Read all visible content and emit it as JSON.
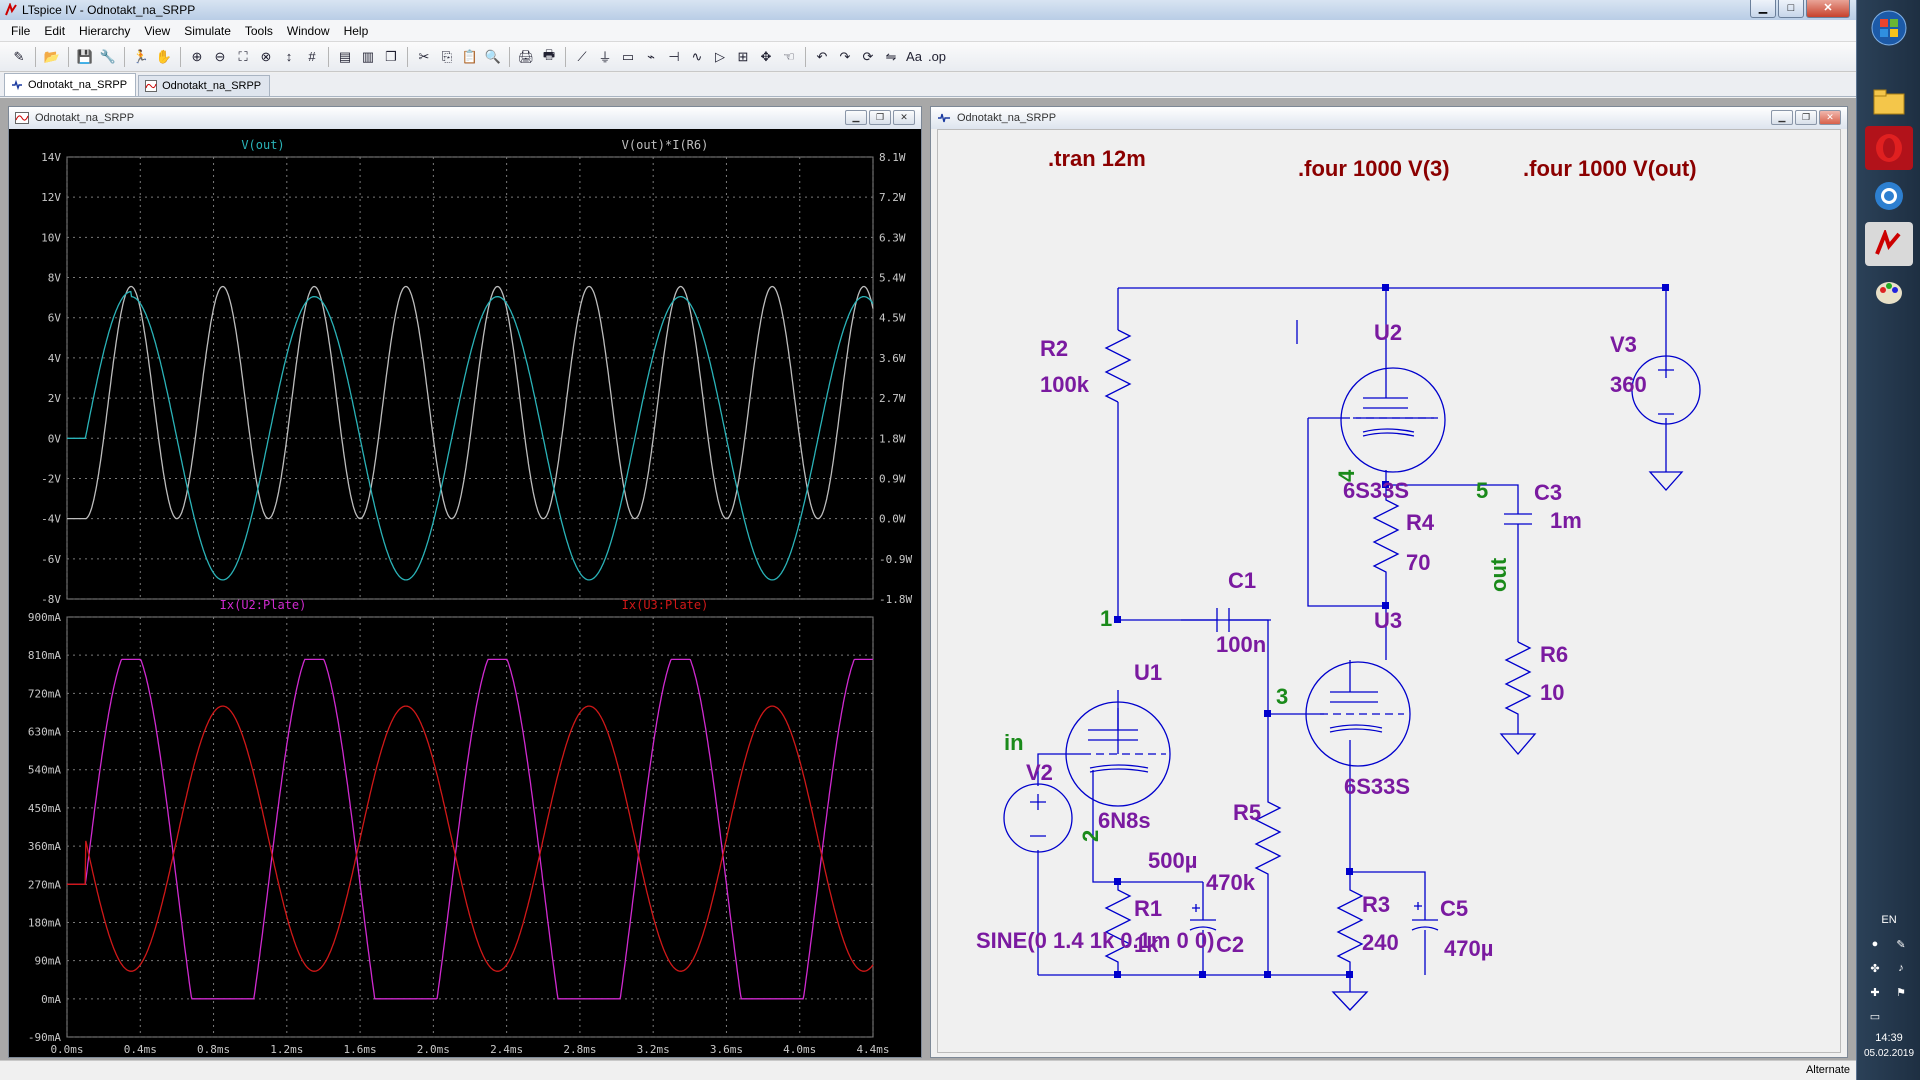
{
  "window": {
    "title": "LTspice IV - Odnotakt_na_SRPP",
    "minimize": "▁",
    "maximize": "□",
    "close": "✕"
  },
  "menu": [
    "File",
    "Edit",
    "Hierarchy",
    "View",
    "Simulate",
    "Tools",
    "Window",
    "Help"
  ],
  "toolbar_icons": [
    "new-schematic-icon",
    "open-icon",
    "save-icon",
    "control-panel-icon",
    "run-icon",
    "halt-icon",
    "zoom-in-icon",
    "zoom-out-icon",
    "zoom-fit-icon",
    "zoom-cancel-icon",
    "autorange-icon",
    "grid-icon",
    "tile-horizontal-icon",
    "tile-vertical-icon",
    "cascade-icon",
    "cut-icon",
    "copy-icon",
    "paste-icon",
    "find-icon",
    "print-setup-icon",
    "print-icon",
    "wire-icon",
    "ground-icon",
    "label-icon",
    "resistor-icon",
    "capacitor-icon",
    "inductor-icon",
    "diode-icon",
    "component-icon",
    "move-icon",
    "drag-icon",
    "undo-icon",
    "redo-icon",
    "rotate-icon",
    "mirror-icon",
    "text-icon",
    "spice-directive-icon"
  ],
  "tabs": [
    {
      "label": "Odnotakt_na_SRPP",
      "icon": "schematic-icon",
      "active": true
    },
    {
      "label": "Odnotakt_na_SRPP",
      "icon": "waveform-icon",
      "active": false
    }
  ],
  "plot_window": {
    "title": "Odnotakt_na_SRPP",
    "pane1": {
      "traces": [
        {
          "label": "V(out)",
          "color": "#2ab3b8"
        },
        {
          "label": "V(out)*I(R6)",
          "color": "#bfbfbf"
        }
      ],
      "left_ticks": [
        "14V",
        "12V",
        "10V",
        "8V",
        "6V",
        "4V",
        "2V",
        "0V",
        "-2V",
        "-4V",
        "-6V",
        "-8V"
      ],
      "right_ticks": [
        "8.1W",
        "7.2W",
        "6.3W",
        "5.4W",
        "4.5W",
        "3.6W",
        "2.7W",
        "1.8W",
        "0.9W",
        "0.0W",
        "-0.9W",
        "-1.8W"
      ]
    },
    "pane2": {
      "traces": [
        {
          "label": "Ix(U2:Plate)",
          "color": "#d02ad0"
        },
        {
          "label": "Ix(U3:Plate)",
          "color": "#d01818"
        }
      ],
      "left_ticks": [
        "900mA",
        "810mA",
        "720mA",
        "630mA",
        "540mA",
        "450mA",
        "360mA",
        "270mA",
        "180mA",
        "90mA",
        "0mA",
        "-90mA"
      ]
    },
    "x_ticks": [
      "0.0ms",
      "0.4ms",
      "0.8ms",
      "1.2ms",
      "1.6ms",
      "2.0ms",
      "2.4ms",
      "2.8ms",
      "3.2ms",
      "3.6ms",
      "4.0ms",
      "4.4ms"
    ]
  },
  "chart_data": [
    {
      "type": "line",
      "title": "",
      "xlabel": "",
      "ylabel": "",
      "xlim": [
        0,
        4.4
      ],
      "ylim": [
        -8,
        14
      ],
      "y2lim": [
        -1.8,
        8.1
      ],
      "grid": true,
      "series": [
        {
          "name": "V(out)",
          "shape": "sine",
          "start_ms": 0.1,
          "freq_khz": 1,
          "amplitude": 7.1,
          "offset": 0,
          "min": -6.8,
          "max": 7.3
        },
        {
          "name": "V(out)*I(R6)",
          "axis": "right",
          "shape": "sine-squared",
          "start_ms": 0.1,
          "freq_khz": 2,
          "min": 0.0,
          "max": 5.2
        }
      ]
    },
    {
      "type": "line",
      "title": "",
      "xlabel": "",
      "ylabel": "",
      "xlim": [
        0,
        4.4
      ],
      "ylim": [
        -90,
        900
      ],
      "grid": true,
      "series": [
        {
          "name": "Ix(U2:Plate)",
          "shape": "clipped-sine",
          "start_ms": 0.1,
          "freq_khz": 1,
          "min": 0,
          "max": 800,
          "idle": 270
        },
        {
          "name": "Ix(U3:Plate)",
          "shape": "sine",
          "start_ms": 0.1,
          "freq_khz": 1,
          "min": 65,
          "max": 690,
          "idle": 270
        }
      ]
    }
  ],
  "schematic_window": {
    "title": "Odnotakt_na_SRPP",
    "directives": [
      ".tran 12m",
      ".four 1000 V(3)",
      ".four 1000 V(out)"
    ],
    "components": {
      "R2": {
        "name": "R2",
        "value": "100k"
      },
      "U2": {
        "name": "U2",
        "value": "6S33S"
      },
      "V3": {
        "name": "V3",
        "value": "360"
      },
      "R4": {
        "name": "R4",
        "value": "70"
      },
      "C3": {
        "name": "C3",
        "value": "1m"
      },
      "R6": {
        "name": "R6",
        "value": "10"
      },
      "C1": {
        "name": "C1",
        "value": "100n"
      },
      "U3": {
        "name": "U3",
        "value": "6S33S"
      },
      "U1": {
        "name": "U1",
        "value": "6N8s"
      },
      "V2": {
        "name": "V2",
        "value": ""
      },
      "R5": {
        "name": "R5",
        "value": "470k"
      },
      "R1": {
        "name": "R1",
        "value": "1k"
      },
      "C2": {
        "name": "C2",
        "value": "500µ"
      },
      "R3": {
        "name": "R3",
        "value": "240"
      },
      "C5": {
        "name": "C5",
        "value": "470µ"
      }
    },
    "nets": [
      "1",
      "2",
      "3",
      "4",
      "5",
      "in",
      "out"
    ],
    "source_spec": "SINE(0 1.4 1k 0.1m 0 0)",
    "colors": {
      "wire": "#0000cc",
      "component": "#0000cc",
      "name": "#7a1aa0",
      "directive": "#8b0000",
      "net": "#1a8a1a"
    }
  },
  "status": {
    "text": "Alternate"
  },
  "taskbar": {
    "language": "EN",
    "time": "14:39",
    "date": "05.02.2019",
    "apps": [
      "windows-start-icon",
      "file-manager-icon",
      "opera-icon",
      "browser-icon",
      "ltspice-icon",
      "paint-icon"
    ]
  }
}
